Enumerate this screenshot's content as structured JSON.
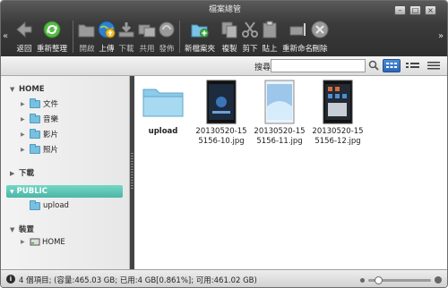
{
  "window": {
    "title": "檔案總管"
  },
  "toolbar": {
    "back": "返回",
    "refresh": "重新整理",
    "open": "開啟",
    "upload": "上傳",
    "download": "下載",
    "share": "共用",
    "publish": "發佈",
    "new_folder": "新檔案夾",
    "copy": "複製",
    "cut": "剪下",
    "paste": "貼上",
    "rename": "重新命名",
    "delete": "刪除"
  },
  "search": {
    "label": "搜尋",
    "value": ""
  },
  "sidebar": {
    "home": {
      "label": "HOME",
      "items": [
        "文件",
        "音樂",
        "影片",
        "照片"
      ]
    },
    "downloads": {
      "label": "下載"
    },
    "public": {
      "label": "PUBLIC",
      "items": [
        "upload"
      ]
    },
    "devices": {
      "label": "裝置",
      "items": [
        "HOME"
      ]
    }
  },
  "files": [
    {
      "name": "upload",
      "type": "folder"
    },
    {
      "name": "20130520-15\n5156-10.jpg",
      "type": "image"
    },
    {
      "name": "20130520-15\n5156-11.jpg",
      "type": "image"
    },
    {
      "name": "20130520-15\n5156-12.jpg",
      "type": "image"
    }
  ],
  "status": {
    "text": "4 個項目; (容量:465.03 GB; 已用:4 GB[0.861%]; 可用:461.02 GB)"
  },
  "zoom": {
    "level": 0.15
  },
  "colors": {
    "accent": "#4ab6a6",
    "toolbar_bg": "#3b3b3b",
    "view_active": "#2c67b3"
  }
}
